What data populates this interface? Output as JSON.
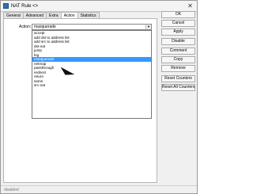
{
  "window": {
    "title": "NAT Rule <>"
  },
  "tabs": [
    "General",
    "Advanced",
    "Extra",
    "Action",
    "Statistics"
  ],
  "action": {
    "label": "Action:",
    "value": "masquerade",
    "options": [
      "accept",
      "add dst to address list",
      "add src to address list",
      "dst-nat",
      "jump",
      "log",
      "masquerade",
      "netmap",
      "passthrough",
      "redirect",
      "return",
      "same",
      "src-nat"
    ],
    "selected_index": 6
  },
  "buttons": [
    "OK",
    "Cancel",
    "Apply",
    "Disable",
    "Comment",
    "Copy",
    "Remove",
    "Reset Counters",
    "Reset All Counters"
  ],
  "status": "disabled",
  "colors": {
    "selection": "#3399ff",
    "window_bg": "#f0f0f0"
  }
}
